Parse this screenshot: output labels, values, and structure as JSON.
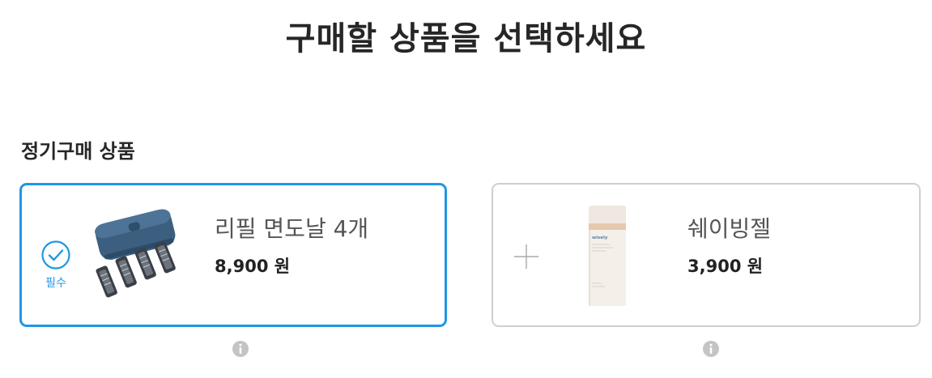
{
  "page": {
    "title": "구매할 상품을 선택하세요"
  },
  "section": {
    "title": "정기구매 상품"
  },
  "products": [
    {
      "name": "리필 면도날 4개",
      "price": "8,900 원",
      "selected": true,
      "badge": "필수",
      "icon": "check-circle-icon",
      "image": "razor-refill-blades-image"
    },
    {
      "name": "쉐이빙젤",
      "price": "3,900 원",
      "selected": false,
      "icon": "plus-icon",
      "image": "shaving-gel-bottle-image",
      "image_brand_text": "wisely"
    }
  ],
  "colors": {
    "accent": "#1e97e6",
    "card_border_inactive": "#cfcfcf",
    "info_icon": "#c4c4c4",
    "text_primary": "#262626",
    "text_secondary": "#555555"
  },
  "icons": {
    "info": "info-icon"
  }
}
